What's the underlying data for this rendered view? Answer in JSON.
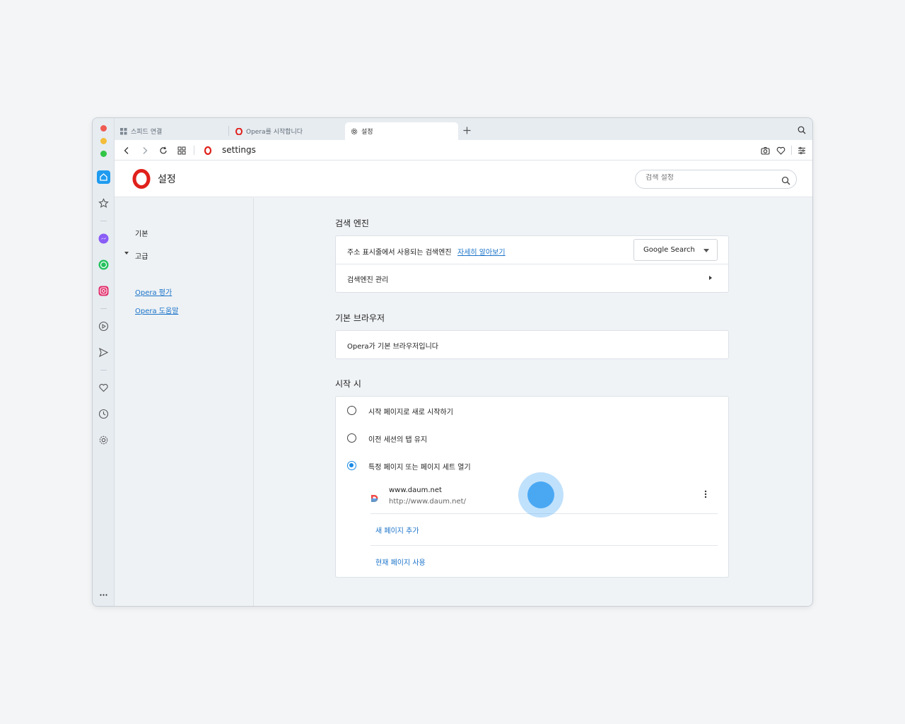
{
  "tabs": [
    {
      "label": "스피드 연결",
      "icon": "speed-dial-icon"
    },
    {
      "label": "Opera를 시작합니다",
      "icon": "opera-icon"
    },
    {
      "label": "설정",
      "icon": "gear-icon"
    }
  ],
  "address_bar": {
    "url": "settings"
  },
  "header": {
    "title": "설정",
    "search_placeholder": "검색 설정"
  },
  "left_nav": {
    "basic": "기본",
    "advanced": "고급",
    "rate_link": "Opera 평가",
    "help_link": "Opera 도움말"
  },
  "search_engine": {
    "section_title": "검색 엔진",
    "address_bar_engine_label": "주소 표시줄에서 사용되는 검색엔진",
    "learn_more": "자세히 알아보기",
    "selected_engine": "Google Search",
    "manage_label": "검색엔진 관리"
  },
  "default_browser": {
    "section_title": "기본 브라우저",
    "status": "Opera가 기본 브라우저입니다"
  },
  "on_startup": {
    "section_title": "시작 시",
    "options": [
      {
        "label": "시작 페이지로 새로 시작하기",
        "checked": false
      },
      {
        "label": "이전 세션의 탭 유지",
        "checked": false
      },
      {
        "label": "특정 페이지 또는 페이지 세트 열기",
        "checked": true
      }
    ],
    "page": {
      "title": "www.daum.net",
      "url": "http://www.daum.net/"
    },
    "add_page": "새 페이지 추가",
    "use_current": "현재 페이지 사용"
  },
  "colors": {
    "accent": "#1a73c9",
    "opera_red": "#e0201b",
    "radio_blue": "#1a8ae6"
  }
}
